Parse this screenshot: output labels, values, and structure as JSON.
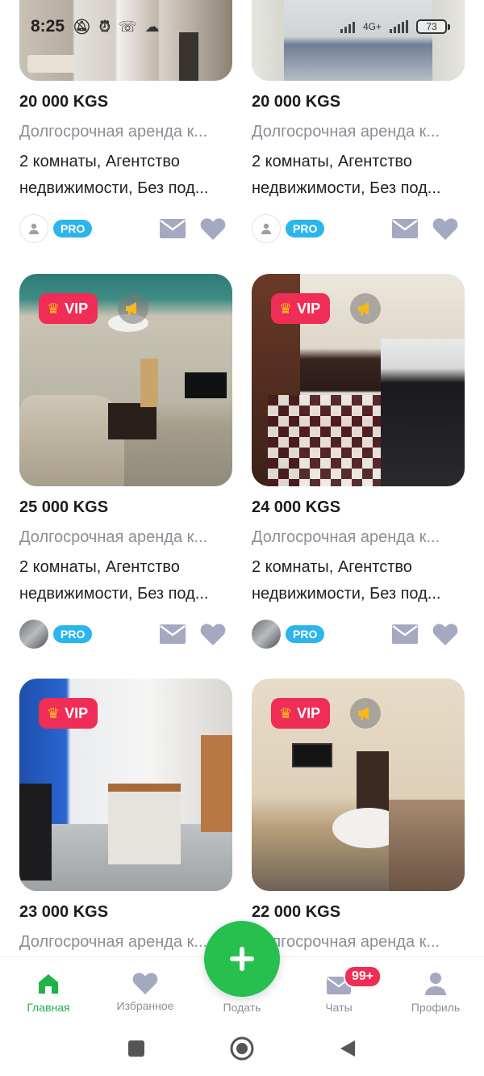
{
  "status_bar": {
    "time": "8:25",
    "network": "4G+",
    "battery": "73"
  },
  "colors": {
    "accent_green": "#27c04f",
    "vip_red": "#ef2d56",
    "pro_blue": "#2bb5ec",
    "muted_gray": "#8a8f96",
    "icon_gray": "#a3a9c0"
  },
  "listings": [
    {
      "price": "20 000 KGS",
      "title": "Долгосрочная аренда к...",
      "desc": "2 комнаты, Агентство недвижимости, Без под...",
      "badge": "PRO",
      "vip": "",
      "avatar": "default-avatar"
    },
    {
      "price": "20 000 KGS",
      "title": "Долгосрочная аренда к...",
      "desc": "2 комнаты, Агентство недвижимости, Без под...",
      "badge": "PRO",
      "vip": "",
      "avatar": "default-avatar"
    },
    {
      "price": "25 000 KGS",
      "title": "Долгосрочная аренда к...",
      "desc": "2 комнаты, Агентство недвижимости, Без под...",
      "badge": "PRO",
      "vip": "VIP",
      "avatar": "building-photo"
    },
    {
      "price": "24 000 KGS",
      "title": "Долгосрочная аренда к...",
      "desc": "2 комнаты, Агентство недвижимости, Без под...",
      "badge": "PRO",
      "vip": "VIP",
      "avatar": "building-photo"
    },
    {
      "price": "23 000 KGS",
      "title": "Долгосрочная аренда к...",
      "desc": "",
      "badge": "",
      "vip": "VIP",
      "avatar": ""
    },
    {
      "price": "22 000 KGS",
      "title": "Долгосрочная аренда к...",
      "desc": "",
      "badge": "",
      "vip": "VIP",
      "avatar": ""
    }
  ],
  "fab": {
    "icon": "plus-icon"
  },
  "bottom_nav": [
    {
      "label": "Главная",
      "icon": "home-icon",
      "active": true
    },
    {
      "label": "Избранное",
      "icon": "heart-icon"
    },
    {
      "label": "Подать",
      "icon": "plus-icon"
    },
    {
      "label": "Чаты",
      "icon": "chat-icon",
      "badge": "99+"
    },
    {
      "label": "Профиль",
      "icon": "profile-icon"
    }
  ]
}
